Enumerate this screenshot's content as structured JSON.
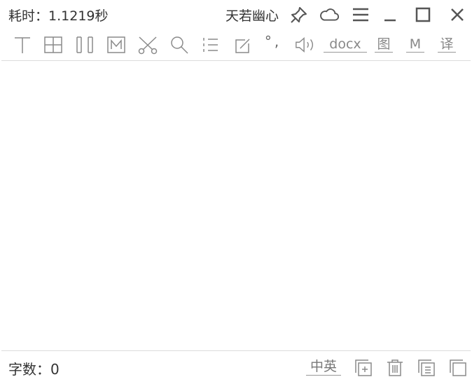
{
  "titlebar": {
    "elapsed_label": "耗时：",
    "elapsed_value": "1.1219秒",
    "user_name": "天若幽心"
  },
  "toolbar": {
    "icons": [
      "text-icon",
      "table-icon",
      "columns-icon",
      "markdown-icon",
      "scissors-icon",
      "search-icon",
      "list-icon",
      "edit-icon",
      "punctuation-icon",
      "speaker-icon"
    ],
    "punctuation_glyphs": "°,",
    "docx_label": "docx",
    "image_label": "图",
    "markdown_label": "M",
    "translate_label": "译"
  },
  "content": {
    "text": ""
  },
  "statusbar": {
    "word_count_label": "字数：",
    "word_count_value": "0",
    "lang_toggle": "中英"
  },
  "colors": {
    "icon": "#8a8a8a",
    "titlebar_icon": "#555555",
    "divider": "#dcdcdc",
    "text": "#333333"
  }
}
